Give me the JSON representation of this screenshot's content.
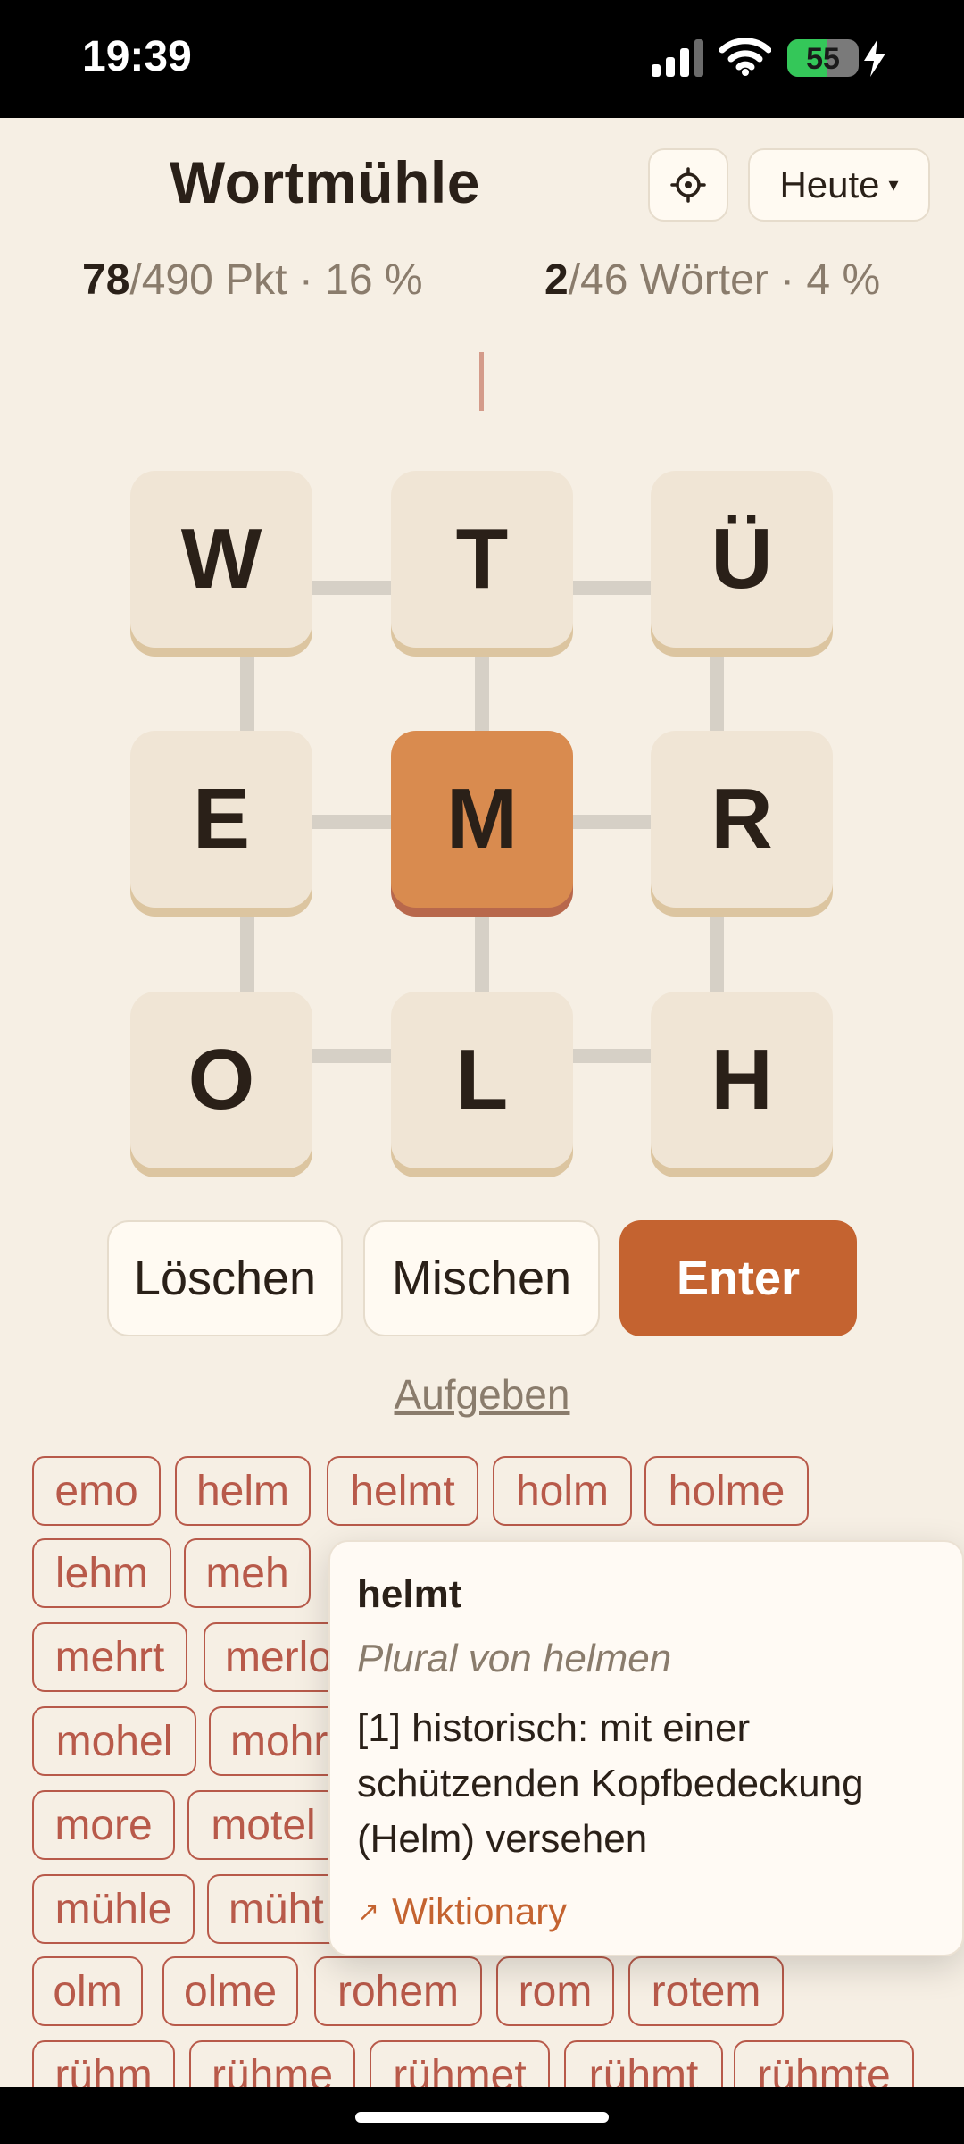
{
  "status_bar": {
    "time": "19:39",
    "battery_percent": "55",
    "battery_level": 0.55,
    "signal_icon": "signal-bars-icon",
    "wifi_icon": "wifi-icon",
    "charging_icon": "bolt-icon"
  },
  "header": {
    "title": "Wortmühle",
    "settings_icon": "settings-icon",
    "date_button_label": "Heute",
    "date_button_caret": "▾"
  },
  "stats": {
    "points_current": "78",
    "points_rest": "/490 Pkt · 16 %",
    "words_current": "2",
    "words_rest": "/46 Wörter · 4 %"
  },
  "board": {
    "tiles": [
      "W",
      "T",
      "Ü",
      "E",
      "M",
      "R",
      "O",
      "L",
      "H"
    ],
    "active_tile": "M"
  },
  "actions": {
    "delete_label": "Löschen",
    "shuffle_label": "Mischen",
    "enter_label": "Enter",
    "give_up_label": "Aufgeben"
  },
  "words": {
    "row1": [
      "emo",
      "helm",
      "helmt",
      "holm",
      "holme"
    ],
    "row2": [
      "lehm",
      "meh"
    ],
    "row3": [
      "mehrt",
      "merlo"
    ],
    "row4": [
      "mohel",
      "mohr"
    ],
    "row5": [
      "more",
      "motel"
    ],
    "row6": [
      "mühle",
      "müht"
    ],
    "row7": [
      "olm",
      "olme",
      "rohem",
      "rom",
      "rotem"
    ],
    "row8": [
      "rühm",
      "rühme",
      "rühmet",
      "rühmt",
      "rühmte"
    ]
  },
  "popover": {
    "word": "helmt",
    "subtitle": "Plural von helmen",
    "definition_line1": "[1] historisch: mit einer",
    "definition_line2": "schützenden Kopfbedeckung",
    "definition_line3": "(Helm) versehen",
    "link_arrow": "↗",
    "link_label": "Wiktionary"
  },
  "colors": {
    "background": "#f6efe4",
    "accent": "#c46330",
    "active_tile": "#d98b4f",
    "chip_border": "#b85a4a"
  }
}
